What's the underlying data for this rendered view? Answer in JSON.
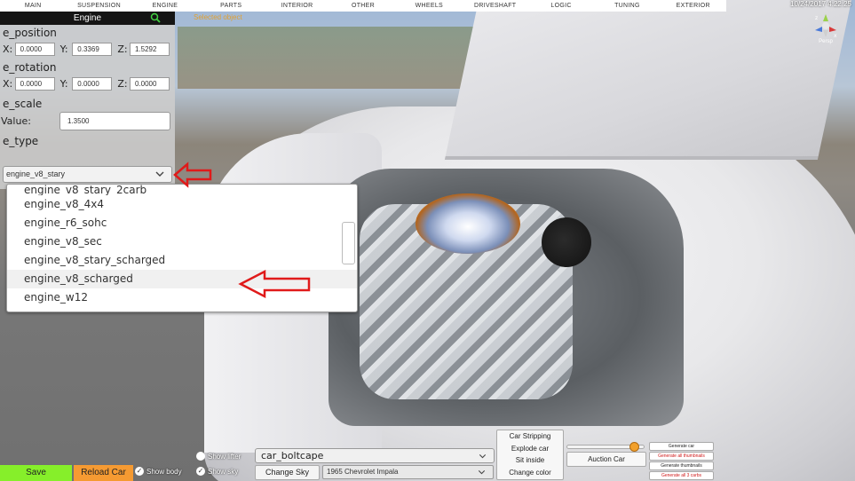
{
  "menu": {
    "items": [
      "MAIN",
      "SUSPENSION",
      "ENGINE",
      "PARTS",
      "INTERIOR",
      "OTHER",
      "WHEELS",
      "DRIVESHAFT",
      "LOGIC",
      "TUNING",
      "EXTERIOR"
    ]
  },
  "datetime": "10/24/2017 4:22:25",
  "selected_object_label": "Selected object",
  "gizmo": {
    "label": "Persp",
    "axis_z": "z",
    "axis_x": "x"
  },
  "panel": {
    "title": "Engine",
    "position": {
      "label": "e_position",
      "x_label": "X:",
      "y_label": "Y:",
      "z_label": "Z:",
      "x": "0.0000",
      "y": "0.3369",
      "z": "1.5292"
    },
    "rotation": {
      "label": "e_rotation",
      "x_label": "X:",
      "y_label": "Y:",
      "z_label": "Z:",
      "x": "0.0000",
      "y": "0.0000",
      "z": "0.0000"
    },
    "scale": {
      "label": "e_scale",
      "value_label": "Value:",
      "value": "1.3500"
    },
    "type": {
      "label": "e_type",
      "selected": "engine_v8_stary"
    }
  },
  "dropdown": {
    "options": [
      "engine_v8_stary_2carb",
      "engine_v8_4x4",
      "engine_r6_sohc",
      "engine_v8_sec",
      "engine_v8_stary_scharged",
      "engine_v8_scharged",
      "engine_w12"
    ]
  },
  "bottom": {
    "save": "Save",
    "reload": "Reload Car",
    "show_body": "Show body",
    "show_lifter": "Show lifter",
    "show_sky": "Show sky",
    "car_name": "car_boltcape",
    "change_sky": "Change Sky",
    "car_model": "1965 Chevrolet Impala",
    "actions": [
      "Car Stripping",
      "Explode car",
      "Sit inside",
      "Change color"
    ],
    "slider_level": 0.92,
    "auction": "Auction Car",
    "generate": [
      "Generate car",
      "Generate all thumbnails",
      "Generate thumbnails",
      "Generate all 3 carbs"
    ]
  },
  "colors": {
    "save_green": "#86ef2a",
    "reload_orange": "#f59a32",
    "arrow_red": "#e01a1a",
    "slider_orange": "#f2a02b"
  }
}
